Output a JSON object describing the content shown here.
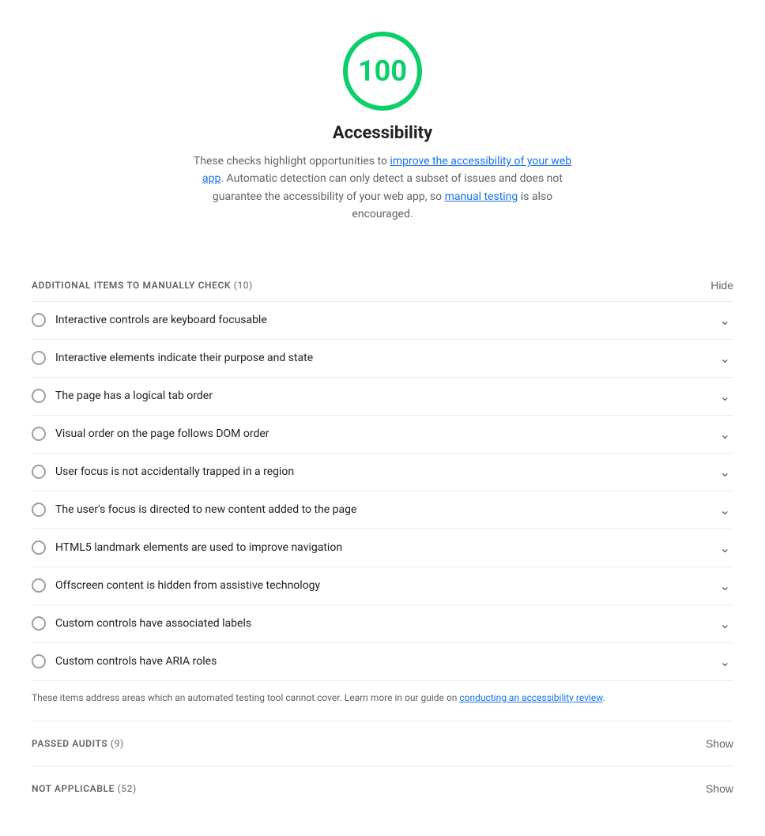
{
  "score": {
    "value": "100",
    "color": "#0cce6b",
    "title": "Accessibility",
    "description_part1": "These checks highlight opportunities to ",
    "link1_text": "improve the accessibility of your web app",
    "link1_href": "#",
    "description_part2": ". Automatic detection can only detect a subset of issues and does not guarantee the accessibility of your web app, so ",
    "link2_text": "manual testing",
    "link2_href": "#",
    "description_part3": " is also encouraged."
  },
  "manual_section": {
    "title": "ADDITIONAL ITEMS TO MANUALLY CHECK",
    "count": "(10)",
    "hide_label": "Hide"
  },
  "audit_items": [
    {
      "label": "Interactive controls are keyboard focusable"
    },
    {
      "label": "Interactive elements indicate their purpose and state"
    },
    {
      "label": "The page has a logical tab order"
    },
    {
      "label": "Visual order on the page follows DOM order"
    },
    {
      "label": "User focus is not accidentally trapped in a region"
    },
    {
      "label": "The user's focus is directed to new content added to the page"
    },
    {
      "label": "HTML5 landmark elements are used to improve navigation"
    },
    {
      "label": "Offscreen content is hidden from assistive technology"
    },
    {
      "label": "Custom controls have associated labels"
    },
    {
      "label": "Custom controls have ARIA roles"
    }
  ],
  "manual_note_part1": "These items address areas which an automated testing tool cannot cover. Learn more in our guide on ",
  "manual_note_link": "conducting an accessibility review",
  "manual_note_part2": ".",
  "passed_section": {
    "title": "PASSED AUDITS",
    "count": "(9)",
    "show_label": "Show"
  },
  "not_applicable_section": {
    "title": "NOT APPLICABLE",
    "count": "(52)",
    "show_label": "Show"
  }
}
